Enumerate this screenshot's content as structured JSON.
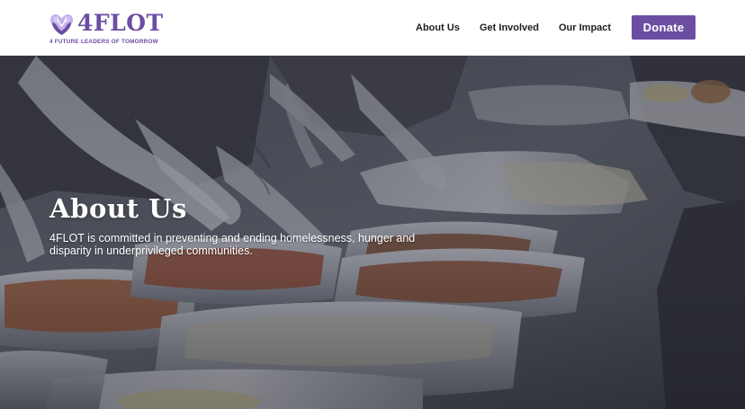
{
  "brand": {
    "name": "4FLOT",
    "tagline": "4 FUTURE LEADERS OF TOMORROW",
    "logo_icon": "hands-heart-icon",
    "color_primary": "#6b4ea2",
    "color_light": "#a98fe0"
  },
  "nav": {
    "items": [
      {
        "label": "About Us"
      },
      {
        "label": "Get Involved"
      },
      {
        "label": "Our Impact"
      }
    ],
    "donate_label": "Donate",
    "donate_color": "#6b4ea2"
  },
  "hero": {
    "title": "About Us",
    "description": "4FLOT is committed in preventing and ending homelessness, hunger and disparity in underprivileged communities.",
    "image_subject": "gloved hands serving food from foil trays",
    "overlay_color": "#2c2d3a"
  }
}
